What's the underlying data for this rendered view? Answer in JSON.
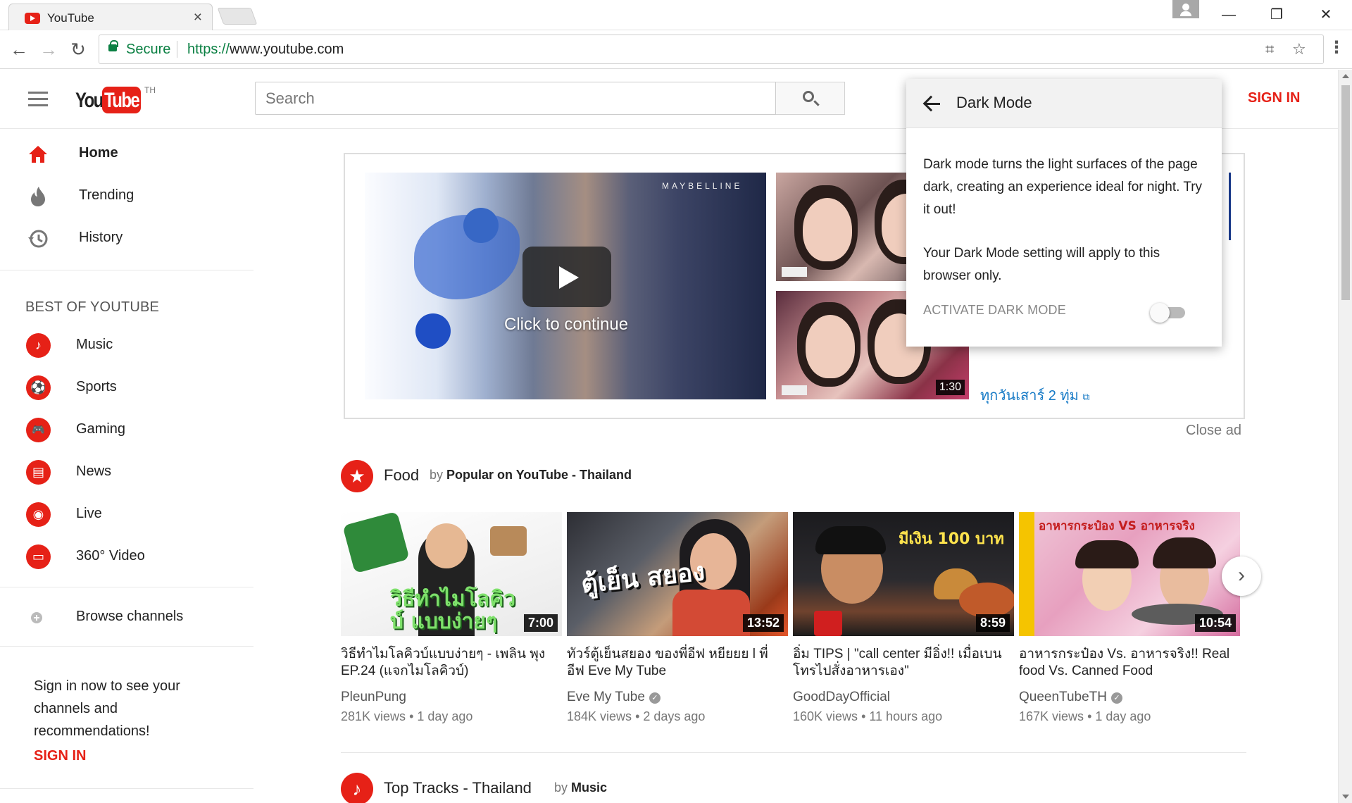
{
  "browser": {
    "tab_title": "YouTube",
    "tab_close": "×",
    "address": {
      "secure_label": "Secure",
      "url_protocol": "https://",
      "url_rest": "www.youtube.com"
    },
    "window_buttons": {
      "minimize": "—",
      "restore": "❐",
      "close": "✕"
    },
    "nav": {
      "back": "←",
      "forward": "→",
      "reload": "↻",
      "menu": "⋮",
      "translate": "⌗",
      "star": "☆"
    }
  },
  "header": {
    "logo_you": "You",
    "logo_tube": "Tube",
    "logo_country": "TH",
    "search_placeholder": "Search",
    "signin": "SIGN IN"
  },
  "sidebar": {
    "main_items": [
      {
        "label": "Home",
        "icon": "home-icon"
      },
      {
        "label": "Trending",
        "icon": "fire-icon"
      },
      {
        "label": "History",
        "icon": "history-icon"
      }
    ],
    "best_heading": "BEST OF YOUTUBE",
    "best_items": [
      {
        "label": "Music",
        "icon": "music-icon",
        "glyph": "♪"
      },
      {
        "label": "Sports",
        "icon": "sports-icon",
        "glyph": "⚽"
      },
      {
        "label": "Gaming",
        "icon": "gaming-icon",
        "glyph": "🎮"
      },
      {
        "label": "News",
        "icon": "news-icon",
        "glyph": "▤"
      },
      {
        "label": "Live",
        "icon": "live-icon",
        "glyph": "◉"
      },
      {
        "label": "360° Video",
        "icon": "360-video-icon",
        "glyph": "▭"
      }
    ],
    "browse_channels": "Browse channels",
    "signin_prompt": "Sign in now to see your channels and recommendations!",
    "signin_link": "SIGN IN"
  },
  "ad": {
    "brand_text": "MAYBELLINE",
    "click_to_continue": "Click to continue",
    "thumb2_duration": "1:30",
    "thai_link": "ทุกวันเสาร์ 2 ทุ่ม",
    "close_ad": "Close ad"
  },
  "shelves": [
    {
      "title": "Food",
      "by_prefix": "by",
      "by_channel": "Popular on YouTube - Thailand",
      "icon_glyph": "★",
      "videos": [
        {
          "duration": "7:00",
          "title": "วิธีทำไมโลคิวบ์แบบง่ายๆ - เพลิน พุง EP.24 (แจกไมโลคิวบ์)",
          "channel": "PleunPung",
          "verified": false,
          "views": "281K views",
          "age": "1 day ago",
          "overlay_text": "วิธีทำไมโลคิวบ์ แบบง่ายๆ"
        },
        {
          "duration": "13:52",
          "title": "ทัวร์ตู้เย็นสยอง ของพี่อีฟ หยียยย l พี่อีฟ Eve My Tube",
          "channel": "Eve My Tube",
          "verified": true,
          "views": "184K views",
          "age": "2 days ago",
          "overlay_text": "ตู้เย็น สยอง"
        },
        {
          "duration": "8:59",
          "title": "อิ่ม TIPS | \"call center มีอิ่ง!! เมื่อเบนโทรไปสั่งอาหารเอง\"",
          "channel": "GoodDayOfficial",
          "verified": false,
          "views": "160K views",
          "age": "11 hours ago",
          "overlay_text": "มีเงิน 100 บาท"
        },
        {
          "duration": "10:54",
          "title": "อาหารกระป๋อง Vs. อาหารจริง!! Real food Vs. Canned Food",
          "channel": "QueenTubeTH",
          "verified": true,
          "views": "167K views",
          "age": "1 day ago",
          "overlay_text": "อาหารกระป๋อง VS อาหารจริง"
        }
      ],
      "next_glyph": "›"
    },
    {
      "title": "Top Tracks - Thailand",
      "by_prefix": "by",
      "by_channel": "Music",
      "icon_glyph": "♪"
    }
  ],
  "dark_mode": {
    "title": "Dark Mode",
    "description": "Dark mode turns the light surfaces of the page dark, creating an experience ideal for night. Try it out!",
    "note": "Your Dark Mode setting will apply to this browser only.",
    "toggle_label": "ACTIVATE DARK MODE",
    "toggle_on": false
  }
}
